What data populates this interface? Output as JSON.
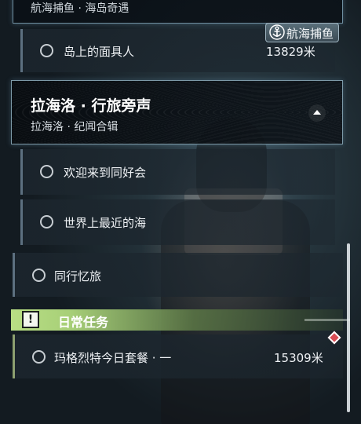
{
  "previous_chapter": {
    "partial_header_text": "航海捕鱼 · 海岛奇遇"
  },
  "tag_badge": {
    "label": "航海捕鱼",
    "icon": "anchor-icon"
  },
  "quests_top": [
    {
      "name": "岛上的面具人",
      "distance": "13829米"
    }
  ],
  "chapter": {
    "title": "拉海洛 · 行旅旁声",
    "subtitle": "拉海洛 · 纪闻合辑",
    "sub_quests": [
      {
        "name": "欢迎来到同好会"
      },
      {
        "name": "世界上最近的海"
      }
    ]
  },
  "standalone_quest": {
    "name": "同行忆旅"
  },
  "daily": {
    "title": "日常任务",
    "accent_color": "#b9df84",
    "quests": [
      {
        "name": "玛格烈特今日套餐 · 一",
        "distance": "15309米",
        "marker_color": "#d94d55"
      }
    ]
  },
  "colors": {
    "row_bg": "#1c262e",
    "row_border": "#5d7080",
    "header_border": "#7d9aa8"
  }
}
